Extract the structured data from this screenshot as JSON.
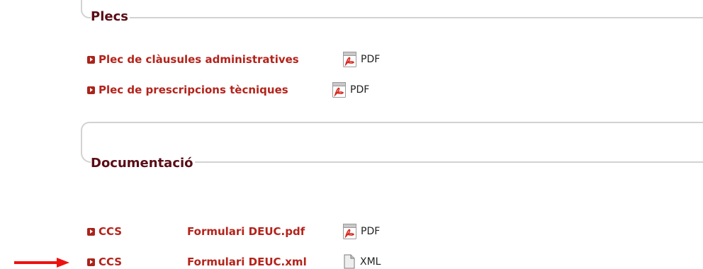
{
  "sections": {
    "plecs": {
      "title": "Plecs",
      "items": [
        {
          "link": "Plec de clàusules administratives",
          "format": "PDF",
          "icon": "pdf-icon"
        },
        {
          "link": "Plec de prescripcions tècniques",
          "format": "PDF",
          "icon": "pdf-icon"
        }
      ]
    },
    "documentacio": {
      "title": "Documentació",
      "items": [
        {
          "organ": "CCS",
          "link": "Formulari DEUC.pdf",
          "format": "PDF",
          "icon": "pdf-icon"
        },
        {
          "organ": "CCS",
          "link": "Formulari DEUC.xml",
          "format": "XML",
          "icon": "xml-file-icon"
        }
      ]
    }
  },
  "annotation": {
    "icon": "red-arrow-icon",
    "color": "#ee1111"
  },
  "colors": {
    "title": "#5a0d16",
    "link": "#b4231b",
    "border": "#d2d2d2"
  }
}
